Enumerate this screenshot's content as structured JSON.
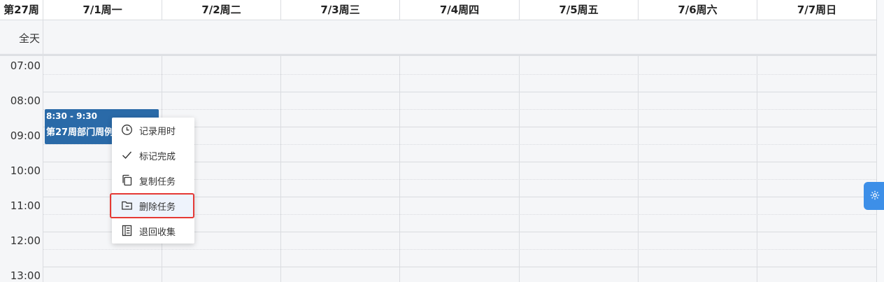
{
  "calendar": {
    "week_label": "第27周",
    "days": [
      "7/1周一",
      "7/2周二",
      "7/3周三",
      "7/4周四",
      "7/5周五",
      "7/6周六",
      "7/7周日"
    ],
    "all_day_label": "全天",
    "time_labels": [
      "07:00",
      "08:00",
      "09:00",
      "10:00",
      "11:00",
      "12:00",
      "13:00"
    ]
  },
  "event": {
    "time": "8:30 - 9:30",
    "title": "第27周部门周例"
  },
  "context_menu": {
    "items": [
      {
        "label": "记录用时",
        "icon": "clock-icon"
      },
      {
        "label": "标记完成",
        "icon": "check-icon"
      },
      {
        "label": "复制任务",
        "icon": "copy-icon"
      },
      {
        "label": "删除任务",
        "icon": "folder-minus-icon"
      },
      {
        "label": "退回收集",
        "icon": "list-document-icon"
      }
    ],
    "highlighted_item": "删除任务"
  },
  "colors": {
    "event_bg": "#2a6aa8",
    "highlight_border": "#e53935",
    "settings_button": "#3d8fe8"
  },
  "settings_button": {
    "icon": "gear-icon"
  }
}
